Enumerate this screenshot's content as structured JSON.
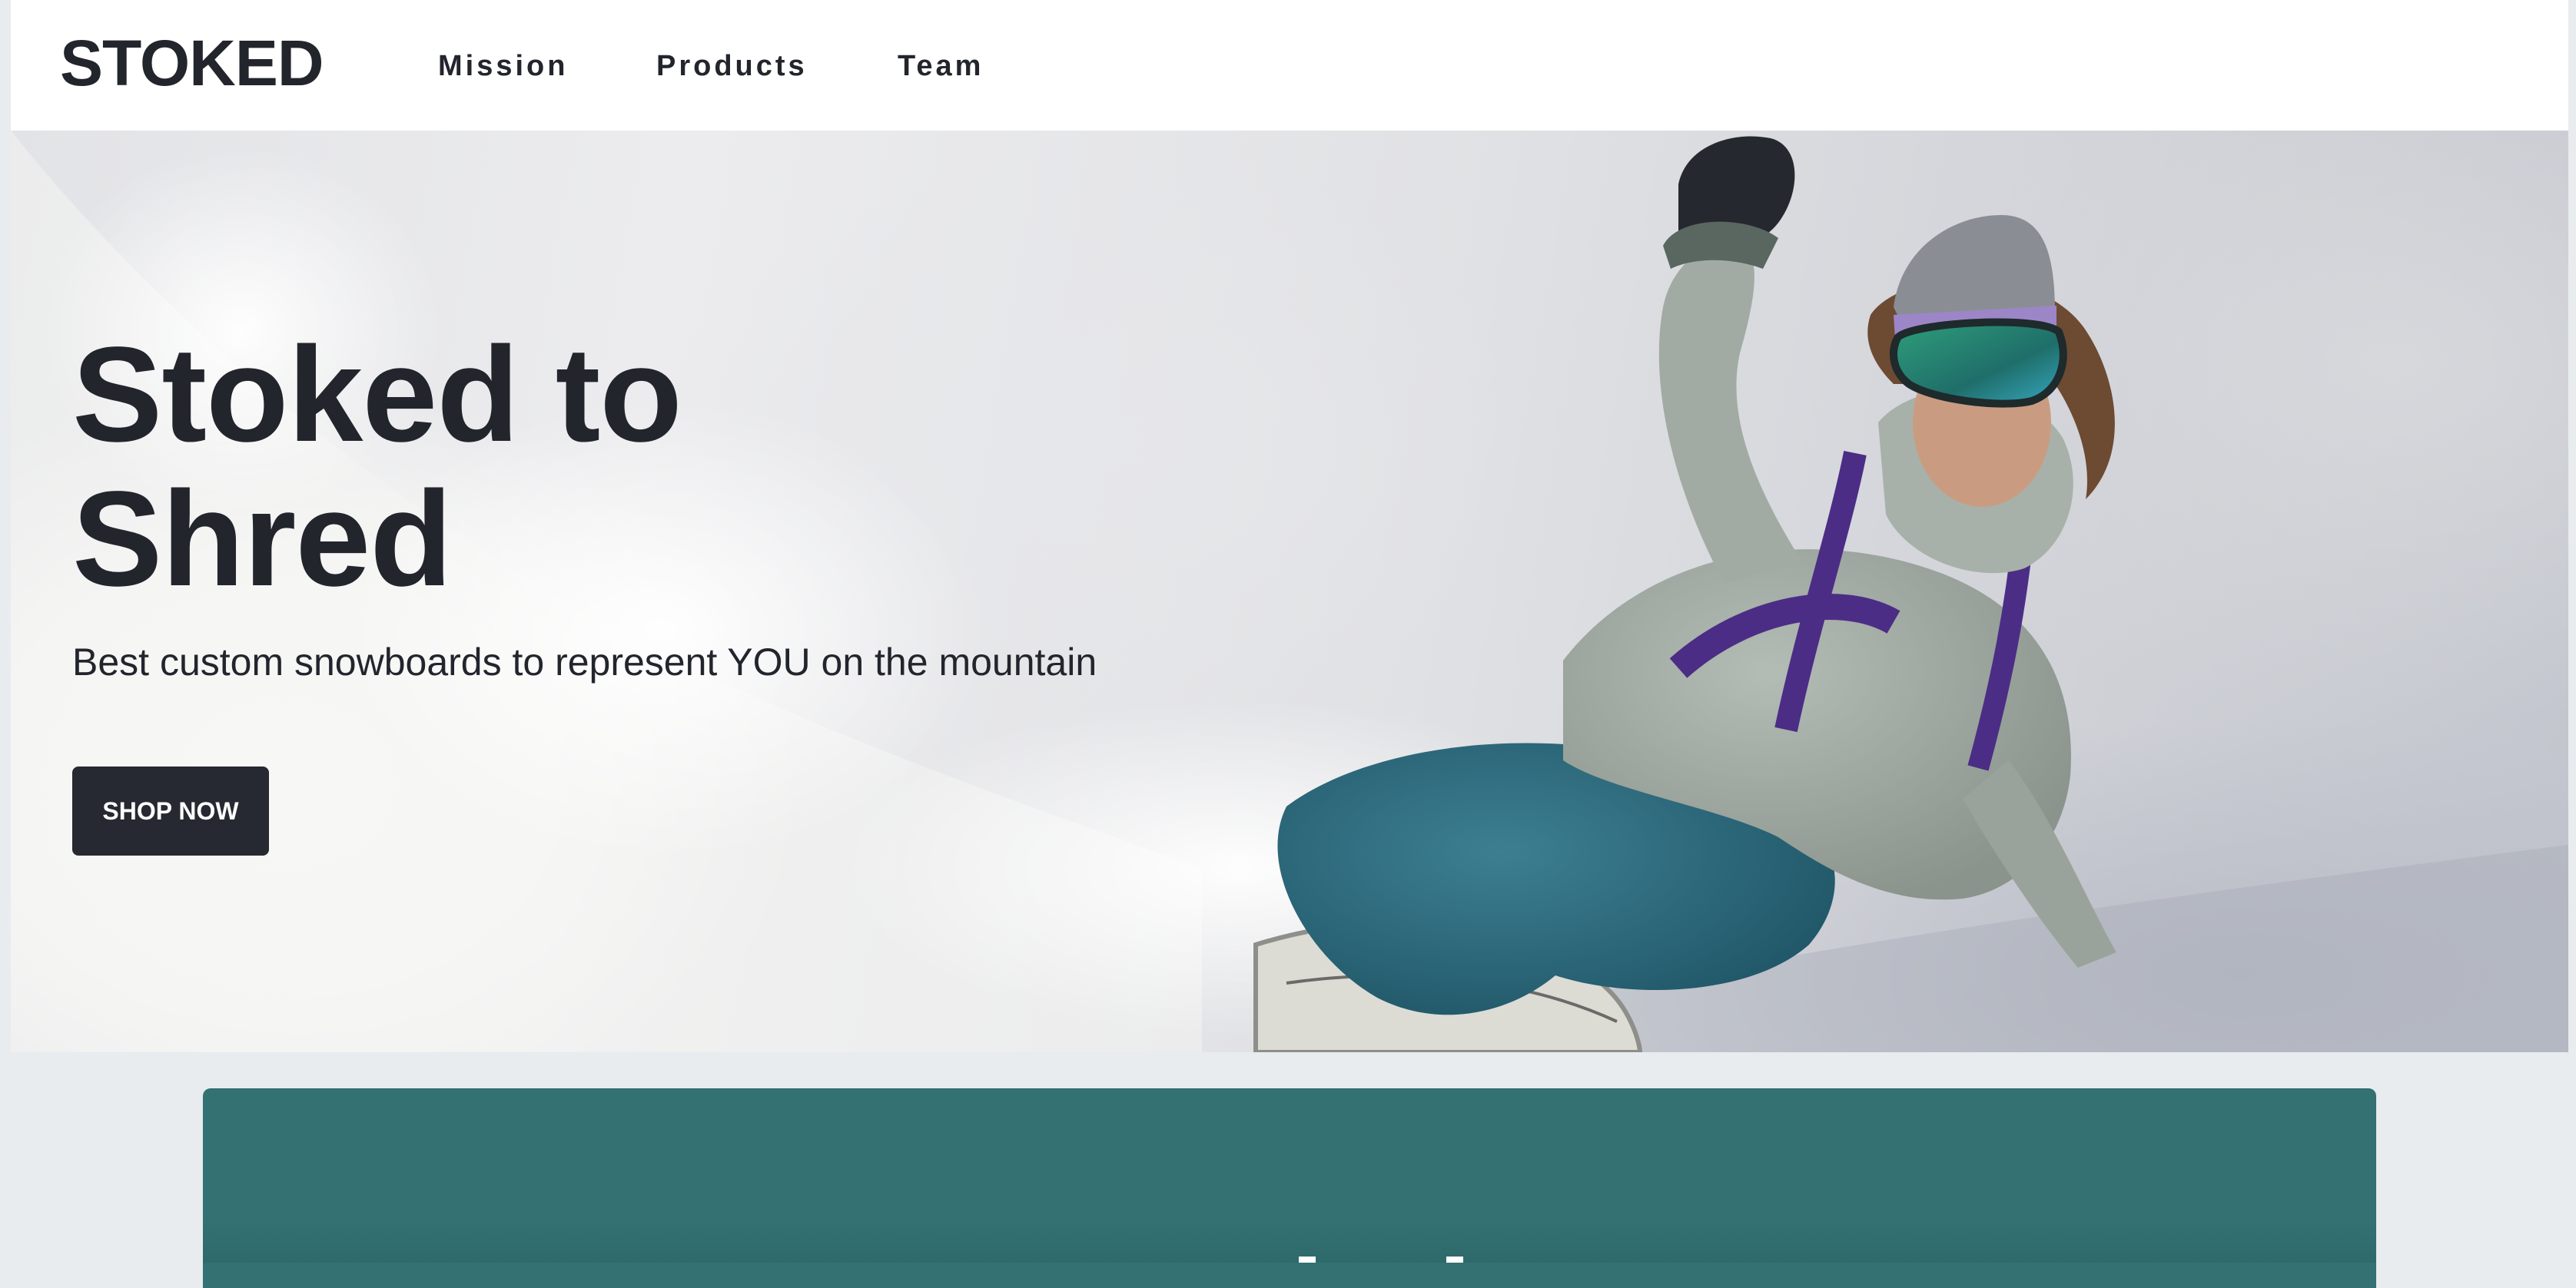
{
  "brand": {
    "logo_text": "STOKED"
  },
  "nav": {
    "items": [
      {
        "label": "Mission"
      },
      {
        "label": "Products"
      },
      {
        "label": "Team"
      }
    ]
  },
  "hero": {
    "title": "Stoked to Shred",
    "subtitle": "Best custom snowboards to represent YOU on the mountain",
    "cta_label": "SHOP NOW",
    "image": "snowboarder-carving-powder-photo"
  },
  "colors": {
    "text_dark": "#23252d",
    "button_bg": "#262931",
    "teal_section": "#337172",
    "page_bg": "#e8ecef"
  }
}
